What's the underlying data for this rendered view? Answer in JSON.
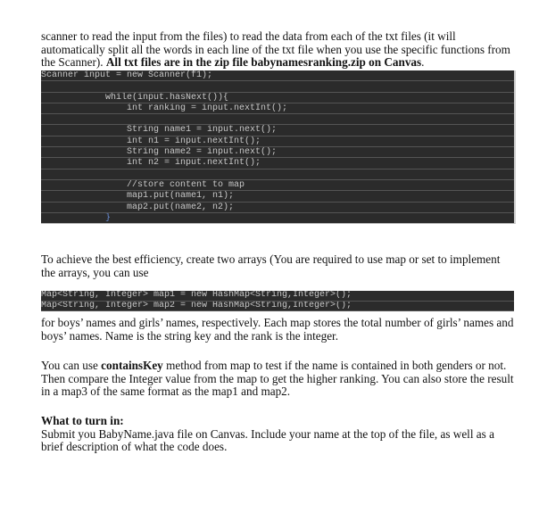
{
  "paragraph1": {
    "text": "scanner to read the input from the files) to read the data from each of the txt files (it will automatically split all the words in each line of the txt file when you use the specific functions from the Scanner). ",
    "bold": "All txt files are in the zip file babynamesranking.zip on Canvas",
    "tail": "."
  },
  "code_block_1": {
    "lines": [
      "Scanner input = new Scanner(f1);",
      "",
      "            while(input.hasNext()){",
      "                int ranking = input.nextInt();",
      "",
      "                String name1 = input.next();",
      "                int n1 = input.nextInt();",
      "                String name2 = input.next();",
      "                int n2 = input.nextInt();",
      "",
      "                //store content to map",
      "                map1.put(name1, n1);",
      "                map2.put(name2, n2);",
      "            }"
    ]
  },
  "paragraph2": {
    "text": "To achieve the best efficiency, create two arrays (You are required to use map or set to implement the arrays, you can use"
  },
  "code_block_2": {
    "lines": [
      "Map<String, Integer> map1 = new HashMap<String,Integer>();",
      "Map<String, Integer> map2 = new HashMap<String,Integer>();"
    ]
  },
  "paragraph3": {
    "text": "for boys’ names and girls’ names, respectively. Each map stores the total number of girls’ names and boys’ names. Name is the string key and the rank is the integer."
  },
  "paragraph4": {
    "prefix": "You can use ",
    "bold": "containsKey",
    "text": " method from map to test if the name is contained in both genders or not. Then compare the Integer value from the map to get the higher ranking. You can also store the result in a map3 of the same format as the map1 and map2."
  },
  "turn_in": {
    "heading": "What to turn in:",
    "text": "Submit you BabyName.java file on Canvas. Include your name at the top of the file, as well as a brief description of what the code does."
  }
}
